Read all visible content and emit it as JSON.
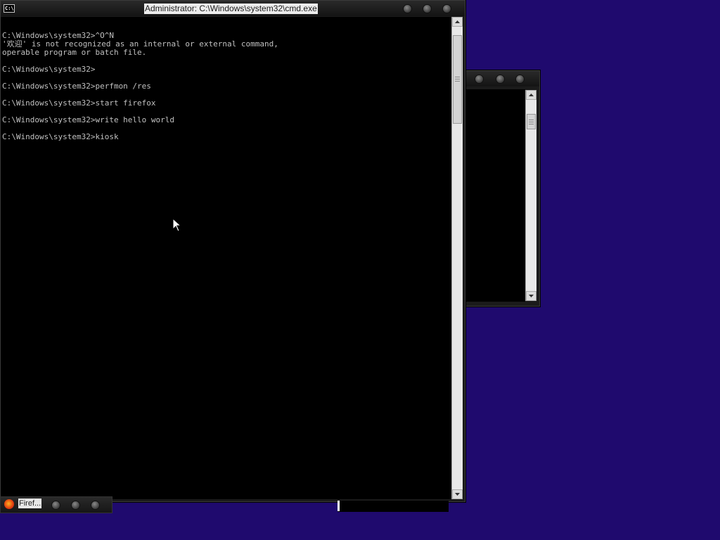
{
  "cmd_window": {
    "title": "Administrator: C:\\Windows\\system32\\cmd.exe",
    "sys_icon_text": "C:\\",
    "console_lines": [
      "",
      "C:\\Windows\\system32>^O^N",
      "'欢迎' is not recognized as an internal or external command,",
      "operable program or batch file.",
      "",
      "C:\\Windows\\system32>",
      "",
      "C:\\Windows\\system32>perfmon /res",
      "",
      "C:\\Windows\\system32>start firefox",
      "",
      "C:\\Windows\\system32>write hello world",
      "",
      "C:\\Windows\\system32>kiosk"
    ]
  },
  "taskbar": {
    "firefox_label": "Firef..."
  },
  "icons": {
    "cmd_sys": "console-icon",
    "minimize": "minimize-icon",
    "maximize": "maximize-icon",
    "close": "close-icon",
    "scroll_up": "chevron-up-icon",
    "scroll_down": "chevron-down-icon",
    "firefox": "firefox-icon",
    "cursor": "cursor-icon"
  },
  "colors": {
    "desktop": "#1f0a6e",
    "console_bg": "#000000",
    "console_text": "#c0c0c0"
  }
}
